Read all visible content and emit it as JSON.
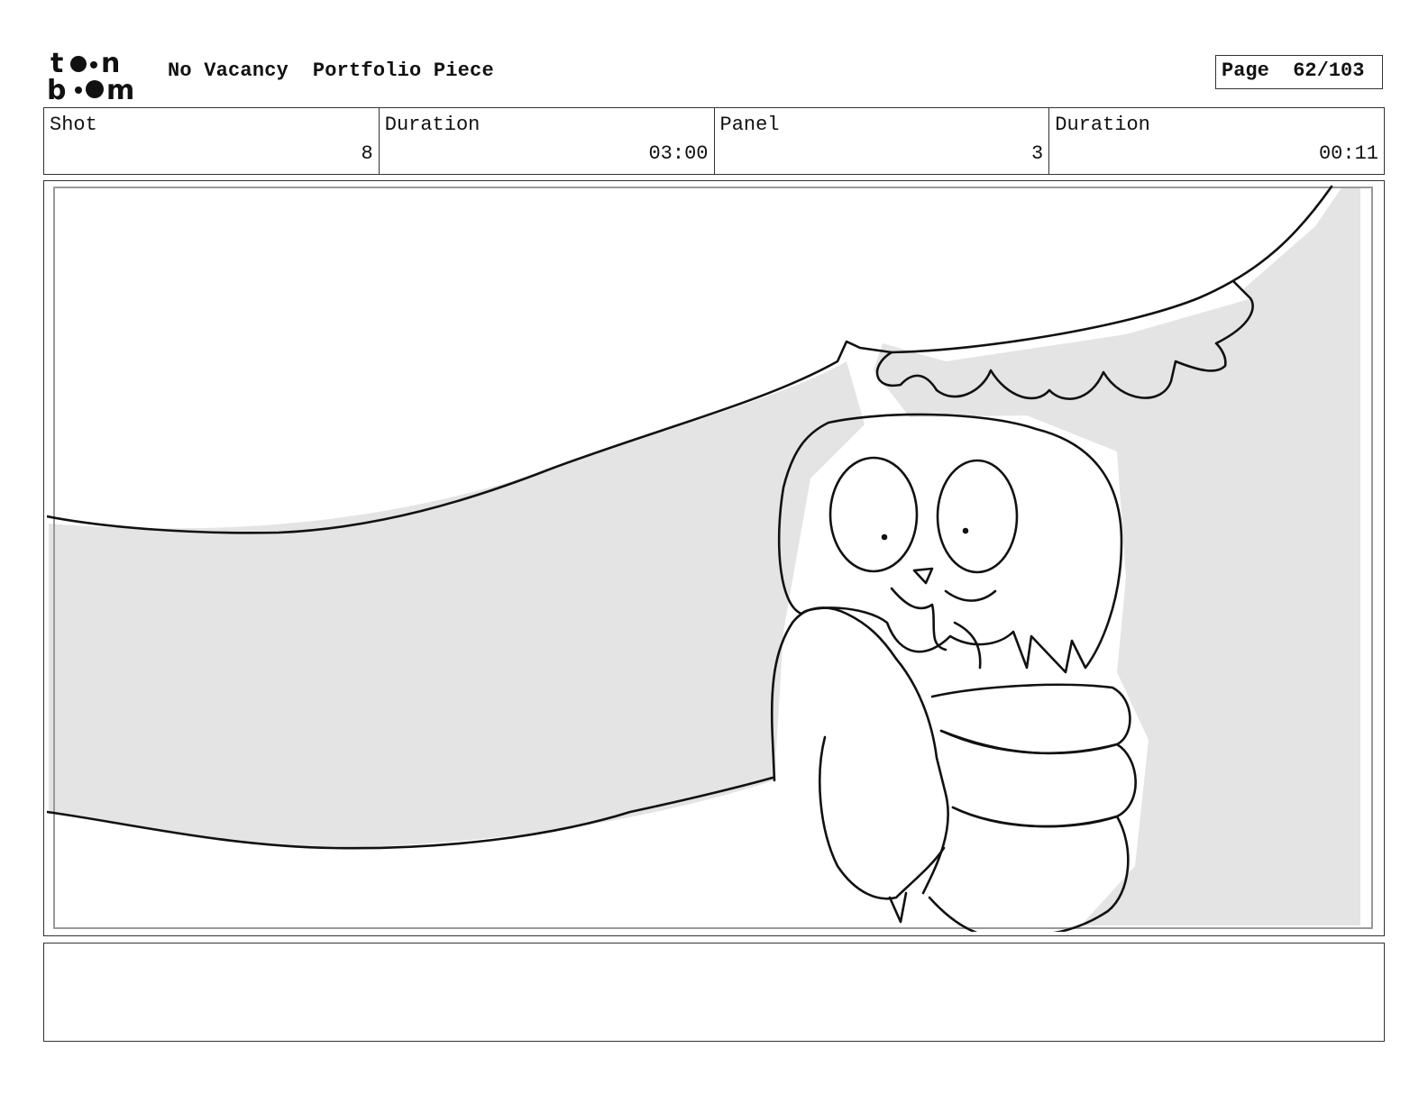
{
  "header": {
    "logo": {
      "icon": "toon-boom-logo",
      "top_text": "toon",
      "bottom_text": "boom"
    },
    "project_title": "No Vacancy  Portfolio Piece",
    "page_label": "Page  62/103"
  },
  "info": {
    "shot_label": "Shot",
    "shot_value": "8",
    "shot_duration_label": "Duration",
    "shot_duration_value": "03:00",
    "panel_label": "Panel",
    "panel_value": "3",
    "panel_duration_label": "Duration",
    "panel_duration_value": "00:11"
  },
  "panel": {
    "description": "",
    "fill_color": "#e4e4e4",
    "line_color": "#111111"
  },
  "notes": {
    "text": ""
  }
}
